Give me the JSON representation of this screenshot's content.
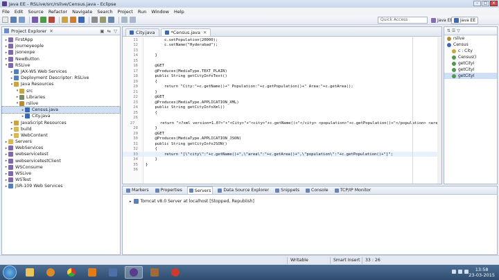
{
  "window": {
    "title": "Java EE - RSLive/src/rslive/Census.java - Eclipse",
    "min": "–",
    "max": "□",
    "close": "✕"
  },
  "menu": [
    "File",
    "Edit",
    "Source",
    "Refactor",
    "Navigate",
    "Search",
    "Project",
    "Run",
    "Window",
    "Help"
  ],
  "toolbar": {
    "quick_access_placeholder": "Quick Access",
    "perspectives": [
      "Java EE",
      "Java EE"
    ]
  },
  "project_explorer": {
    "tab_label": "Project Explorer",
    "tab_close": "✕",
    "tools": "▣ ⇆ ▽",
    "items": [
      {
        "label": "FirstApp",
        "depth": 0,
        "arrow": "▸",
        "icon": "project-icon"
      },
      {
        "label": "journeyeople",
        "depth": 0,
        "arrow": "▸",
        "icon": "project-icon"
      },
      {
        "label": "jsonexpe",
        "depth": 0,
        "arrow": "▸",
        "icon": "project-icon"
      },
      {
        "label": "NewButton",
        "depth": 0,
        "arrow": "▸",
        "icon": "project-icon"
      },
      {
        "label": "RSLive",
        "depth": 0,
        "arrow": "▾",
        "icon": "project-icon"
      },
      {
        "label": "JAX-WS Web Services",
        "depth": 1,
        "arrow": "▸",
        "icon": "server-icon"
      },
      {
        "label": "Deployment Descriptor: RSLive",
        "depth": 1,
        "arrow": "▸",
        "icon": "server-icon"
      },
      {
        "label": "Java Resources",
        "depth": 1,
        "arrow": "▾",
        "icon": "src-icon"
      },
      {
        "label": "src",
        "depth": 2,
        "arrow": "▾",
        "icon": "src-icon"
      },
      {
        "label": "Libraries",
        "depth": 2,
        "arrow": "▸",
        "icon": "lib-icon"
      },
      {
        "label": "rslive",
        "depth": 2,
        "arrow": "▾",
        "icon": "package-icon"
      },
      {
        "label": "Census.java",
        "depth": 3,
        "arrow": "▸",
        "icon": "java-file-icon",
        "selected": true
      },
      {
        "label": "City.java",
        "depth": 3,
        "arrow": "▸",
        "icon": "java-file-icon"
      },
      {
        "label": "JavaScript Resources",
        "depth": 1,
        "arrow": "▸",
        "icon": "src-icon"
      },
      {
        "label": "build",
        "depth": 1,
        "arrow": "▸",
        "icon": "folder-icon"
      },
      {
        "label": "WebContent",
        "depth": 1,
        "arrow": "▸",
        "icon": "folder-icon"
      },
      {
        "label": "Servers",
        "depth": 0,
        "arrow": "▸",
        "icon": "folder-icon"
      },
      {
        "label": "WebServices",
        "depth": 0,
        "arrow": "▸",
        "icon": "project-icon"
      },
      {
        "label": "webservicetest",
        "depth": 0,
        "arrow": "▸",
        "icon": "project-icon"
      },
      {
        "label": "webservicetestClient",
        "depth": 0,
        "arrow": "▸",
        "icon": "project-icon"
      },
      {
        "label": "WSConsume",
        "depth": 0,
        "arrow": "▸",
        "icon": "project-icon"
      },
      {
        "label": "WSLive",
        "depth": 0,
        "arrow": "▸",
        "icon": "project-icon"
      },
      {
        "label": "WSTest",
        "depth": 0,
        "arrow": "▸",
        "icon": "project-icon"
      },
      {
        "label": "JSR-109 Web Services",
        "depth": 0,
        "arrow": "▸",
        "icon": "server-icon"
      }
    ]
  },
  "editor": {
    "tabs": [
      {
        "label": "City.java",
        "active": false
      },
      {
        "label": "*Census.java",
        "active": true
      }
    ],
    "tab_close": "✕",
    "lines": [
      {
        "n": "11",
        "t": "        c.setPopulation(20000);"
      },
      {
        "n": "12",
        "t": "        c.setName(\"Hyderabad\");"
      },
      {
        "n": "13",
        "t": ""
      },
      {
        "n": "14",
        "t": "    }"
      },
      {
        "n": "15",
        "t": ""
      },
      {
        "n": "16",
        "t": "    @GET"
      },
      {
        "n": "17",
        "t": "    @Produces(MediaType.TEXT_PLAIN)"
      },
      {
        "n": "18",
        "t": "    public String getCityInfoText()"
      },
      {
        "n": "19",
        "t": "    {"
      },
      {
        "n": "20",
        "t": "        return \"City:\"+c.getName()+\" Population:\"+c.getPopulation()+\" Area:\"+c.getArea();"
      },
      {
        "n": "21",
        "t": "    }"
      },
      {
        "n": "22",
        "t": "    @GET"
      },
      {
        "n": "23",
        "t": "    @Produces(MediaType.APPLICATION_XML)"
      },
      {
        "n": "24",
        "t": "    public String getCityInfoXml()"
      },
      {
        "n": "25",
        "t": "    {"
      },
      {
        "n": "26",
        "t": ""
      },
      {
        "n": "27",
        "t": "        return \"<?xml version=1.0?>\"+\"<City>\"+\"<city>\"+c.getName()+\"</city> <population>\"+c.getPopulation()+\"</population> <area"
      },
      {
        "n": "28",
        "t": "    }"
      },
      {
        "n": "29",
        "t": "    @GET"
      },
      {
        "n": "30",
        "t": "    @Produces(MediaType.APPLICATION_JSON)"
      },
      {
        "n": "31",
        "t": "    public String getCityInfoJSON()"
      },
      {
        "n": "32",
        "t": "    {"
      },
      {
        "n": "33",
        "t": "        return \"[\\\"city\\\":\"+c.getName()+\",\\\"area\\\":\"+c.getArea()+\",\\\"population\\\":\"+c.getPopulation()+\"]\";"
      },
      {
        "n": "34",
        "t": "    }"
      },
      {
        "n": "35",
        "t": "}"
      },
      {
        "n": "36",
        "t": ""
      }
    ]
  },
  "outline": {
    "tools": "⇅ ☰ ▽",
    "items": [
      {
        "label": "rslive",
        "depth": 0
      },
      {
        "label": "Census",
        "depth": 0
      },
      {
        "label": "c : City",
        "depth": 1
      },
      {
        "label": "Census()",
        "depth": 1
      },
      {
        "label": "getCityI",
        "depth": 1
      },
      {
        "label": "getCityI",
        "depth": 1
      },
      {
        "label": "getCityI",
        "depth": 1,
        "selected": true
      }
    ]
  },
  "bottom_panel": {
    "tabs": [
      "Markers",
      "Properties",
      "Servers",
      "Data Source Explorer",
      "Snippets",
      "Console",
      "TCP/IP Monitor"
    ],
    "active_tab": "Servers",
    "server_row": "Tomcat v8.0 Server at localhost  [Stopped, Republish]",
    "server_arrow": "▸"
  },
  "statusbar": {
    "writable": "Writable",
    "insert_mode": "Smart Insert",
    "position": "33 : 26"
  },
  "taskbar": {
    "time": "13:58",
    "date": "23-03-2015"
  },
  "colors": {
    "accent": "#3a68b4",
    "selection": "#cfe0f6",
    "keyword": "#7f0055",
    "string": "#2a00ff"
  }
}
